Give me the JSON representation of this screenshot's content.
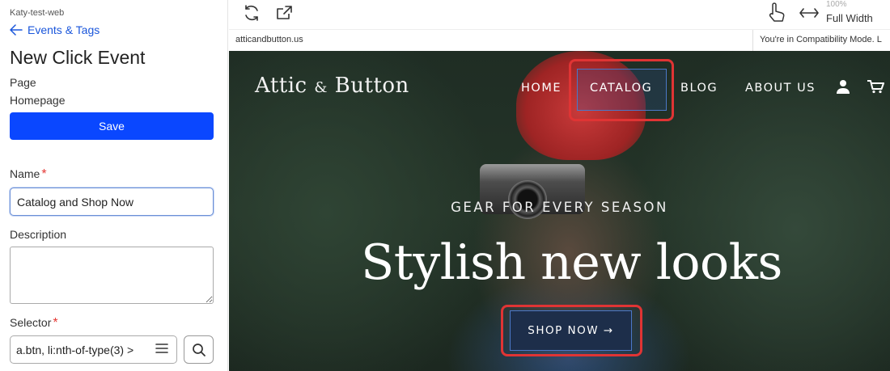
{
  "workspace": "Katy-test-web",
  "back_link": "Events & Tags",
  "title": "New Click Event",
  "page_label": "Page",
  "page_value": "Homepage",
  "save_label": "Save",
  "name_label": "Name",
  "name_value": "Catalog and Shop Now",
  "description_label": "Description",
  "description_value": "",
  "selector_label": "Selector",
  "selector_value": "a.btn, li:nth-of-type(3) >",
  "required_mark": "*",
  "toolbar": {
    "zoom": "100%",
    "width_mode": "Full Width",
    "icons": [
      "refresh-icon",
      "open-external-icon",
      "pointer-hand-icon",
      "resize-horizontal-icon"
    ]
  },
  "url": "atticandbutton.us",
  "compat_notice": "You're in Compatibility Mode. L",
  "site": {
    "logo_left": "Attic",
    "logo_amp": "&",
    "logo_right": "Button",
    "nav": [
      "HOME",
      "CATALOG",
      "BLOG",
      "ABOUT US"
    ],
    "eyebrow": "GEAR FOR EVERY SEASON",
    "headline": "Stylish new looks",
    "cta": "SHOP NOW →"
  },
  "colors": {
    "primary": "#0a47ff",
    "link": "#1a56db",
    "highlight": "#e03434",
    "required": "#e53935",
    "cta_bg": "#1d2e4a"
  }
}
